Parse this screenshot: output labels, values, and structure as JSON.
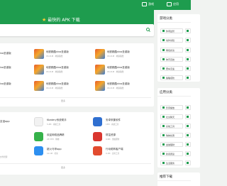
{
  "topnav": {
    "item1": "游戏",
    "item2": "应用"
  },
  "header": {
    "title": "最快的 APK 下载"
  },
  "games": {
    "rows": [
      {
        "left": "ivo圣诞版",
        "title": "地铁跑酷vivo圣诞版",
        "meta": "93.21M · 地铁跑酷"
      },
      {
        "left": "ivo圣诞版",
        "title": "地铁跑酷vivo圣诞版",
        "meta": "93.21M · 地铁跑酷"
      },
      {
        "left": "ivo圣诞版",
        "title": "地铁跑酷vivo圣诞版",
        "meta": "93.21M · 地铁跑酷"
      }
    ],
    "more": "更多"
  },
  "apps": {
    "rows": [
      [
        {
          "title": "友谊app",
          "meta": "",
          "color": "#3a77d4"
        },
        {
          "title": "Kbatery系统助手",
          "meta": "5.4M · 系统工具",
          "color": "#f2f2f2"
        },
        {
          "title": "安卓采集软件",
          "meta": "13M · 系统工具",
          "color": "#2f6fd0"
        }
      ],
      [
        {
          "title": "",
          "meta": "",
          "color": "#ffffff"
        },
        {
          "title": "欢迎网络品牌精",
          "meta": "23.57M · 购物",
          "color": "#36b24a"
        },
        {
          "title": "财富资源",
          "meta": "9.9M · 金融理财",
          "color": "#d9362f"
        }
      ],
      [
        {
          "title": "",
          "meta": "文件管理",
          "color": "#ffffff"
        },
        {
          "title": "超火马甲app",
          "meta": "10.1M · 社交",
          "color": "#2d8ff0"
        },
        {
          "title": "行动助阵客户端",
          "meta": "9.1M · 实用工具",
          "color": "#e24b2f"
        }
      ]
    ],
    "more": "更多"
  },
  "sidebar": {
    "game_cat_title": "游戏分类",
    "game_cats": [
      "休闲益智",
      "动作冒险",
      "角色扮演",
      "体育竞技",
      "赛车竞速",
      "策略塔防"
    ],
    "app_cat_title": "应用分类",
    "app_cats": [
      "影音播放",
      "社交聊天",
      "系统工具",
      "购物优惠",
      "金融理财",
      "新闻阅读",
      "生活服务"
    ],
    "recommend_title": "推荐下载"
  },
  "colors": {
    "brand": "#1e9c4e",
    "star": "#ffcc33"
  }
}
